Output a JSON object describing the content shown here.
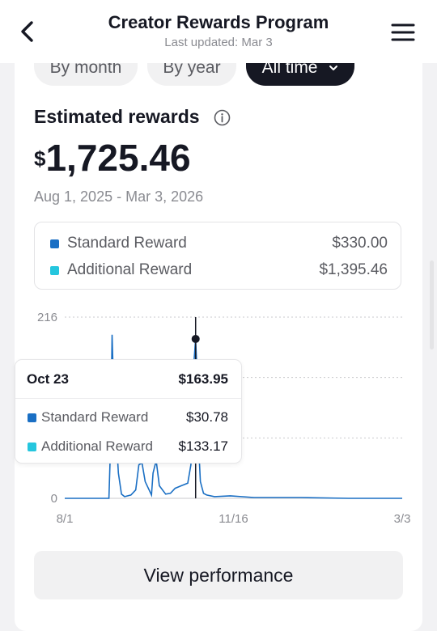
{
  "header": {
    "title": "Creator Rewards Program",
    "subtitle": "Last updated: Mar 3",
    "back_icon": "chevron-left-icon",
    "menu_icon": "hamburger-menu-icon"
  },
  "filters": {
    "options": [
      "By month",
      "By year",
      "All time"
    ],
    "selected": "All time",
    "selected_icon": "chevron-down-icon"
  },
  "summary": {
    "label": "Estimated rewards",
    "info_icon": "info-icon",
    "currency": "$",
    "amount": "1,725.46",
    "date_range": "Aug 1, 2025 - Mar 3, 2026"
  },
  "legend": [
    {
      "name": "Standard Reward",
      "value": "$330.00",
      "color": "#1a6fc4"
    },
    {
      "name": "Additional Reward",
      "value": "$1,395.46",
      "color": "#25c6de"
    }
  ],
  "tooltip": {
    "date": "Oct 23",
    "total": "$163.95",
    "rows": [
      {
        "name": "Standard Reward",
        "value": "$30.78",
        "color": "#1a6fc4"
      },
      {
        "name": "Additional Reward",
        "value": "$133.17",
        "color": "#25c6de"
      }
    ]
  },
  "chart_data": {
    "type": "line",
    "y_ticks": [
      "216",
      "0"
    ],
    "x_ticks": [
      "8/1",
      "11/16",
      "3/3"
    ],
    "ylim": [
      0,
      216
    ],
    "grid": true,
    "series": [
      {
        "name": "Standard Reward",
        "color": "#1a6fc4",
        "x_day": [
          0,
          15,
          28,
          29,
          30,
          31,
          34,
          36,
          38,
          42,
          45,
          47,
          49,
          51,
          55,
          56,
          58,
          60,
          64,
          67,
          70,
          74,
          78,
          80,
          82,
          83,
          84,
          85,
          86,
          88,
          90,
          95,
          105,
          120,
          150,
          180,
          214
        ],
        "values": [
          0,
          0,
          0,
          60,
          195,
          130,
          30,
          5,
          2,
          4,
          10,
          40,
          42,
          20,
          4,
          30,
          45,
          15,
          5,
          6,
          12,
          15,
          18,
          40,
          164,
          190,
          145,
          60,
          20,
          6,
          4,
          2,
          3,
          1,
          1,
          0,
          0
        ]
      }
    ],
    "highlight": {
      "x_day": 83,
      "label": "Oct 23"
    }
  },
  "cta": {
    "label": "View performance"
  }
}
